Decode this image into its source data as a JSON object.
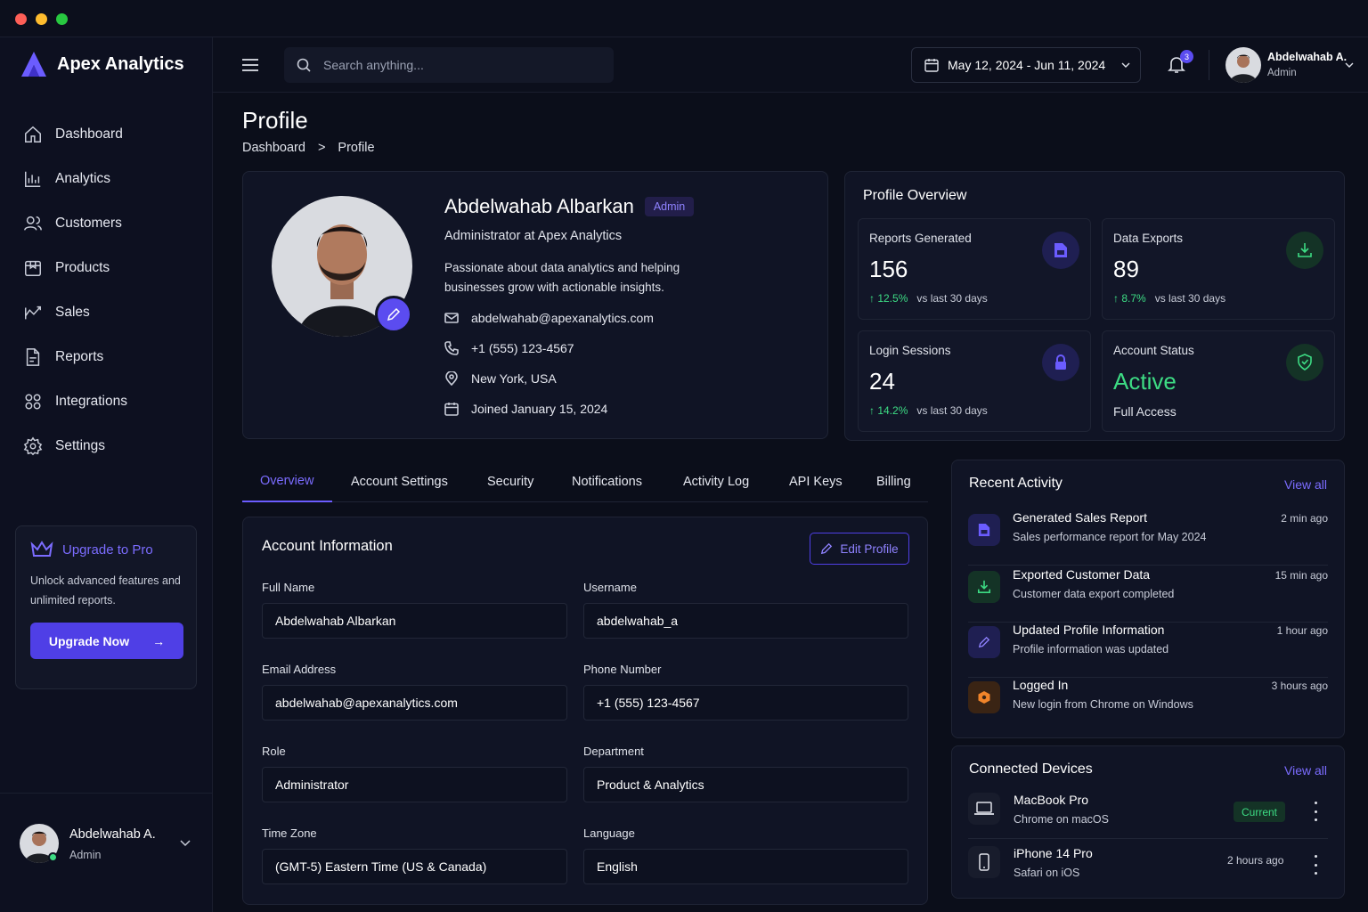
{
  "window": {
    "dots": [
      "#fe5f57",
      "#febc2e",
      "#28c840"
    ]
  },
  "brand": {
    "name": "Apex Analytics",
    "accent": "#6b5cff"
  },
  "sidebar": {
    "items": [
      {
        "label": "Dashboard",
        "icon": "home-icon"
      },
      {
        "label": "Analytics",
        "icon": "bar-chart-icon"
      },
      {
        "label": "Customers",
        "icon": "users-icon"
      },
      {
        "label": "Products",
        "icon": "box-icon"
      },
      {
        "label": "Sales",
        "icon": "trend-icon"
      },
      {
        "label": "Reports",
        "icon": "file-icon"
      },
      {
        "label": "Integrations",
        "icon": "grid-icon"
      },
      {
        "label": "Settings",
        "icon": "gear-icon"
      }
    ],
    "upgrade": {
      "title": "Upgrade to Pro",
      "desc": "Unlock advanced features and unlimited reports.",
      "button": "Upgrade Now"
    },
    "user": {
      "name": "Abdelwahab A.",
      "role": "Admin"
    }
  },
  "header": {
    "search_placeholder": "Search anything...",
    "date_range": "May 12, 2024 - Jun 11, 2024",
    "notification_count": "3",
    "user": {
      "name": "Abdelwahab A.",
      "role": "Admin"
    }
  },
  "page": {
    "title": "Profile",
    "breadcrumb": {
      "root": "Dashboard",
      "separator": ">",
      "current": "Profile"
    }
  },
  "profile": {
    "name": "Abdelwahab Albarkan",
    "badge": "Admin",
    "title": "Administrator at Apex Analytics",
    "bio_line1": "Passionate about data analytics and helping",
    "bio_line2": "businesses grow with actionable insights.",
    "email": "abdelwahab@apexanalytics.com",
    "phone": "+1 (555) 123-4567",
    "location": "New York, USA",
    "joined": "Joined January 15, 2024"
  },
  "overview": {
    "title": "Profile Overview",
    "stats": [
      {
        "label": "Reports Generated",
        "value": "156",
        "change": "↑ 12.5%",
        "period": "vs last 30 days",
        "icon": "document-icon"
      },
      {
        "label": "Data Exports",
        "value": "89",
        "change": "↑ 8.7%",
        "period": "vs last 30 days",
        "icon": "download-icon"
      },
      {
        "label": "Login Sessions",
        "value": "24",
        "change": "↑ 14.2%",
        "period": "vs last 30 days",
        "icon": "lock-icon"
      },
      {
        "label": "Account Status",
        "value": "Active",
        "sub": "Full Access",
        "icon": "shield-check-icon"
      }
    ]
  },
  "tabs": [
    "Overview",
    "Account Settings",
    "Security",
    "Notifications",
    "Activity Log",
    "API Keys",
    "Billing"
  ],
  "account": {
    "title": "Account Information",
    "edit_button": "Edit Profile",
    "fields": [
      {
        "label": "Full Name",
        "value": "Abdelwahab Albarkan"
      },
      {
        "label": "Username",
        "value": "abdelwahab_a"
      },
      {
        "label": "Email Address",
        "value": "abdelwahab@apexanalytics.com"
      },
      {
        "label": "Phone Number",
        "value": "+1 (555) 123-4567"
      },
      {
        "label": "Role",
        "value": "Administrator"
      },
      {
        "label": "Department",
        "value": "Product & Analytics"
      },
      {
        "label": "Time Zone",
        "value": "(GMT-5) Eastern Time (US & Canada)"
      },
      {
        "label": "Language",
        "value": "English"
      }
    ]
  },
  "activity": {
    "title": "Recent Activity",
    "view_all": "View all",
    "items": [
      {
        "title": "Generated Sales Report",
        "sub": "Sales performance report for May 2024",
        "time": "2 min ago",
        "icon": "document-icon"
      },
      {
        "title": "Exported Customer Data",
        "sub": "Customer data export completed",
        "time": "15 min ago",
        "icon": "download-icon"
      },
      {
        "title": "Updated Profile Information",
        "sub": "Profile information was updated",
        "time": "1 hour ago",
        "icon": "pencil-icon"
      },
      {
        "title": "Logged In",
        "sub": "New login from Chrome on Windows",
        "time": "3 hours ago",
        "icon": "login-icon"
      }
    ]
  },
  "devices": {
    "title": "Connected Devices",
    "view_all": "View all",
    "items": [
      {
        "name": "MacBook Pro",
        "sub": "Chrome on macOS",
        "status": "Current",
        "icon": "laptop-icon"
      },
      {
        "name": "iPhone 14 Pro",
        "sub": "Safari on iOS",
        "status": "2 hours ago",
        "icon": "phone-icon"
      }
    ]
  }
}
